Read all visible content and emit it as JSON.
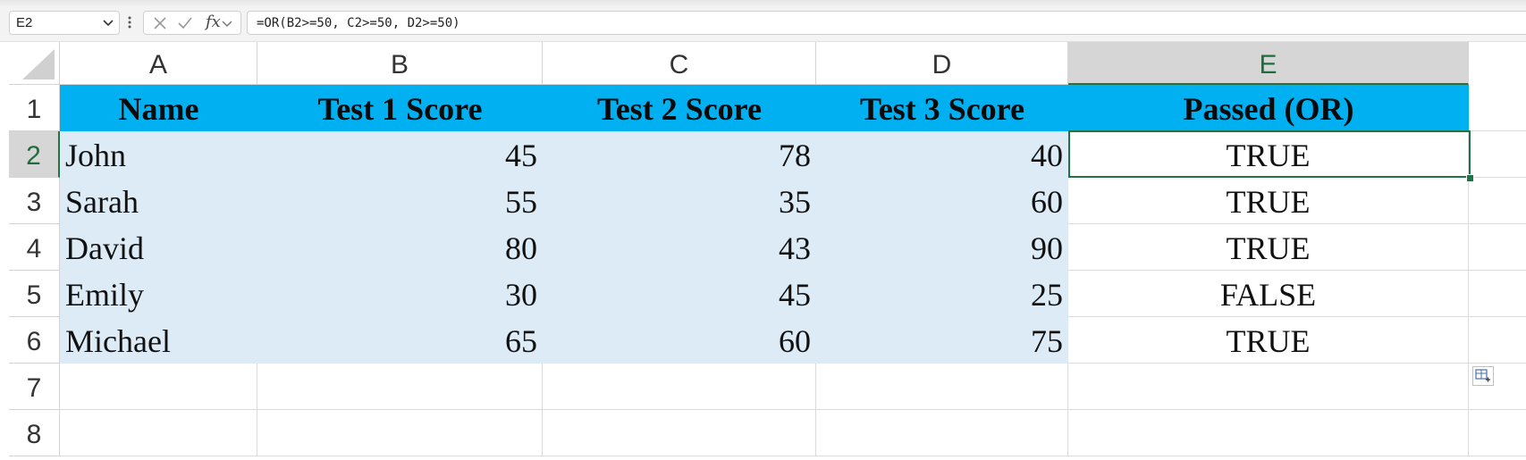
{
  "name_box": {
    "value": "E2"
  },
  "formula_bar": {
    "fx_label": "fx",
    "formula": "=OR(B2>=50, C2>=50, D2>=50)"
  },
  "columns": [
    "A",
    "B",
    "C",
    "D",
    "E"
  ],
  "rows": [
    "1",
    "2",
    "3",
    "4",
    "5",
    "6",
    "7",
    "8"
  ],
  "active_cell": {
    "column": "E",
    "row": "2"
  },
  "table": {
    "headers": [
      "Name",
      "Test 1 Score",
      "Test 2 Score",
      "Test 3 Score",
      "Passed (OR)"
    ],
    "rows": [
      [
        "John",
        "45",
        "78",
        "40",
        "TRUE"
      ],
      [
        "Sarah",
        "55",
        "35",
        "60",
        "TRUE"
      ],
      [
        "David",
        "80",
        "43",
        "90",
        "TRUE"
      ],
      [
        "Emily",
        "30",
        "45",
        "25",
        "FALSE"
      ],
      [
        "Michael",
        "65",
        "60",
        "75",
        "TRUE"
      ]
    ]
  },
  "colors": {
    "header_fill": "#00b0f0",
    "data_fill": "#ddebf7",
    "selection": "#217346"
  },
  "icons": {
    "name_box_dropdown": "chevron-down-icon",
    "more_options": "vertical-ellipsis-icon",
    "cancel": "close-icon",
    "enter": "checkmark-icon",
    "insert_function": "fx-icon",
    "quick_analysis": "quick-analysis-icon"
  }
}
